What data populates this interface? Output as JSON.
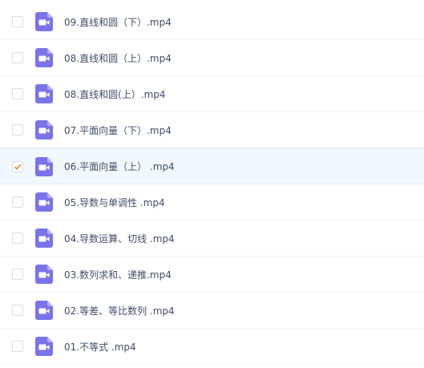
{
  "files": [
    {
      "name": "09.直线和圆（下）.mp4",
      "selected": false,
      "icon": "video-file-icon"
    },
    {
      "name": "08.直线和圆（上）.mp4",
      "selected": false,
      "icon": "video-file-icon"
    },
    {
      "name": "08.直线和圆(上）.mp4",
      "selected": false,
      "icon": "video-file-icon"
    },
    {
      "name": "07.平面向量（下）.mp4",
      "selected": false,
      "icon": "video-file-icon"
    },
    {
      "name": "06.平面向量（上） .mp4",
      "selected": true,
      "icon": "video-file-icon"
    },
    {
      "name": "05.导数与单调性 .mp4",
      "selected": false,
      "icon": "video-file-icon"
    },
    {
      "name": "04.导数运算、切线 .mp4",
      "selected": false,
      "icon": "video-file-icon"
    },
    {
      "name": "03.数列求和、递推.mp4",
      "selected": false,
      "icon": "video-file-icon"
    },
    {
      "name": "02.等差、等比数列 .mp4",
      "selected": false,
      "icon": "video-file-icon"
    },
    {
      "name": "01.不等式 .mp4",
      "selected": false,
      "icon": "video-file-icon"
    }
  ],
  "colors": {
    "icon": "#7a73ea",
    "check": "#f08a3a",
    "selected_row": "#f1f8fe",
    "text": "#424e67"
  }
}
